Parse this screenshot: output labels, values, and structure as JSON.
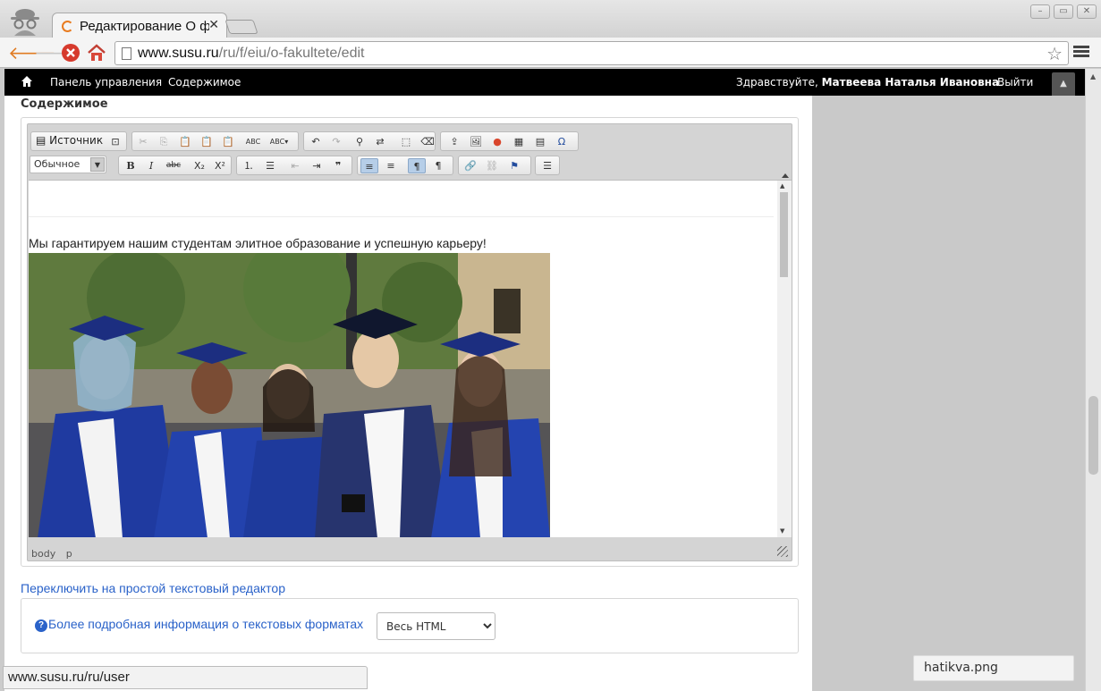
{
  "browser": {
    "tab_title": "Редактирование О ф",
    "url_host": "www.susu.ru",
    "url_path": "/ru/f/eiu/o-fakultete/edit",
    "status_url": "www.susu.ru/ru/user",
    "download_file": "hatikva.png"
  },
  "adminbar": {
    "items": [
      "Панель управления",
      "Содержимое"
    ],
    "greeting": "Здравствуйте,",
    "user_name": "Матвеева Наталья Ивановна",
    "dot": ".",
    "logout": "Выйти"
  },
  "form": {
    "field_label": "Содержимое",
    "editor": {
      "source_label": "Источник",
      "format_value": "Обычное",
      "content_text": "Мы гарантируем нашим студентам элитное образование и успешную карьеру!",
      "path": [
        "body",
        "p"
      ]
    },
    "switch_link": "Переключить на простой текстовый редактор",
    "text_formats_help": "Более подробная информация о текстовых форматах",
    "text_format_value": "Весь HTML"
  },
  "colors": {
    "link": "#2a62c9",
    "adminbar_bg": "#000000",
    "toolbar_active": "#b6cee8"
  }
}
